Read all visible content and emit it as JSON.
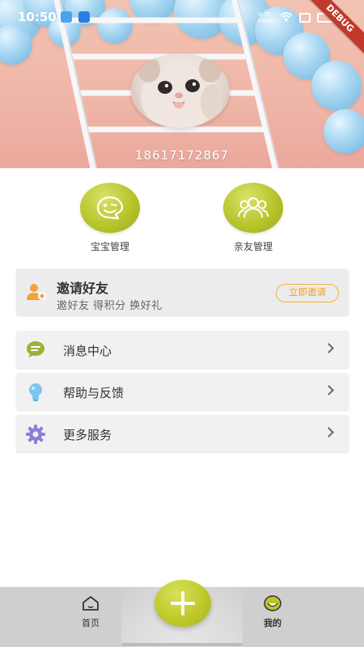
{
  "status_bar": {
    "time": "10:50",
    "network_speed": "0.35 KB/S",
    "debug_label": "DEBUG"
  },
  "profile": {
    "phone": "18617172867",
    "avatar_icon": "cat-photo"
  },
  "quick_actions": [
    {
      "label": "宝宝管理",
      "icon": "smiley-wink-icon"
    },
    {
      "label": "亲友管理",
      "icon": "group-people-icon"
    }
  ],
  "invite": {
    "title": "邀请好友",
    "subtitle": "邀好友 得积分 换好礼",
    "button_label": "立即邀请",
    "icon": "add-user-icon"
  },
  "menu": [
    {
      "label": "消息中心",
      "icon": "message-icon"
    },
    {
      "label": "帮助与反馈",
      "icon": "lightbulb-icon"
    },
    {
      "label": "更多服务",
      "icon": "gear-icon"
    }
  ],
  "bottom_nav": {
    "home_label": "首页",
    "mine_label": "我的",
    "fab_icon": "plus-icon"
  },
  "colors": {
    "accent": "#b8c52b",
    "invite_button": "#f1a020",
    "header_pink": "#efb6a8",
    "balloon_blue": "#8cc4e6"
  }
}
